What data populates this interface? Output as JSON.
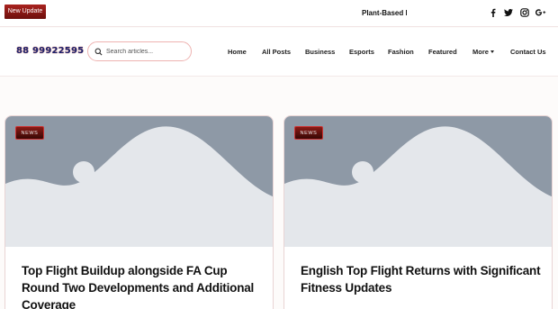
{
  "topbar": {
    "update_label": "New Update",
    "ticker_text": "Plant-Based Diets",
    "social": [
      "facebook-icon",
      "twitter-icon",
      "instagram-icon",
      "google-plus-icon"
    ]
  },
  "header": {
    "logo_text": "88 99922595",
    "search_placeholder": "Search articles...",
    "nav": [
      "Home",
      "All Posts",
      "Business",
      "Esports",
      "Fashion",
      "Featured",
      "More",
      "Contact Us"
    ]
  },
  "posts": [
    {
      "badge": "NEWS",
      "title": "Top Flight Buildup alongside FA Cup Round Two Developments and Additional Coverage"
    },
    {
      "badge": "NEWS",
      "title": "English Top Flight Returns with Significant Fitness Updates"
    }
  ],
  "colors": {
    "accent": "#9e1f1b",
    "placeholder_bg": "#8e99a6",
    "placeholder_fg": "#e4e7eb",
    "logo": "#1a2370"
  }
}
